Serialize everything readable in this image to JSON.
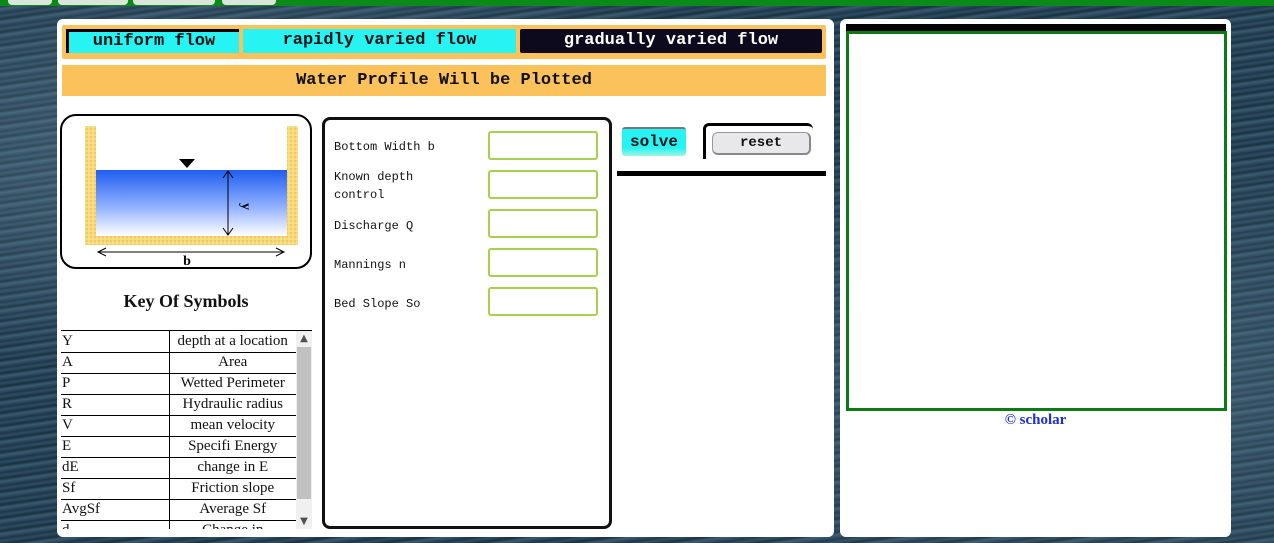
{
  "tabs": [
    {
      "label": "uniform flow"
    },
    {
      "label": "rapidly varied flow"
    },
    {
      "label": "gradually varied flow"
    }
  ],
  "message": "Water Profile Will be Plotted",
  "figure": {
    "depth_label": "y",
    "width_label": "b"
  },
  "key": {
    "title": "Key Of Symbols",
    "rows": [
      {
        "symbol": "Y",
        "desc": "depth at a location"
      },
      {
        "symbol": "A",
        "desc": "Area"
      },
      {
        "symbol": "P",
        "desc": "Wetted Perimeter"
      },
      {
        "symbol": "R",
        "desc": "Hydraulic radius"
      },
      {
        "symbol": "V",
        "desc": "mean velocity"
      },
      {
        "symbol": "E",
        "desc": "Specifi Energy"
      },
      {
        "symbol": "dE",
        "desc": "change in E"
      },
      {
        "symbol": "Sf",
        "desc": "Friction slope"
      },
      {
        "symbol": "AvgSf",
        "desc": "Average Sf"
      },
      {
        "symbol": "d",
        "desc": "Change in"
      }
    ]
  },
  "inputs": [
    {
      "label": "Bottom Width b",
      "value": ""
    },
    {
      "label": "Known depth control",
      "value": ""
    },
    {
      "label": "Discharge Q",
      "value": ""
    },
    {
      "label": "Mannings n",
      "value": ""
    },
    {
      "label": "Bed Slope So",
      "value": ""
    }
  ],
  "buttons": {
    "solve": "solve",
    "reset": "reset"
  },
  "credit": "© scholar",
  "colors": {
    "tab_active": "#27f3f3",
    "tab_dark": "#0c0a1c",
    "orange_bar": "#fbc25c",
    "plot_border": "#0d7a12",
    "input_border": "#a6d04e",
    "credit": "#1a2fd8"
  }
}
